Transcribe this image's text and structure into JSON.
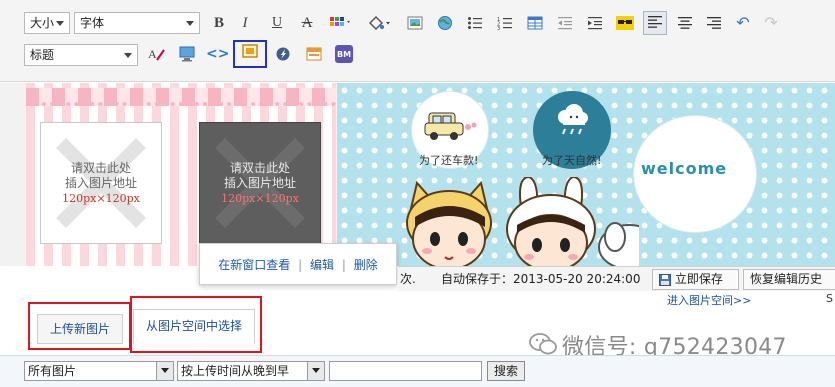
{
  "toolbar": {
    "font_size_label": "大小",
    "font_family_label": "字体",
    "heading_label": "标题",
    "buttons": {
      "bold": "B",
      "italic": "I",
      "underline": "U",
      "strikethrough": "A"
    }
  },
  "canvas": {
    "placeholder_1": {
      "line1": "请双击此处",
      "line2": "插入图片地址",
      "size": "120px×120px"
    },
    "placeholder_2": {
      "line1": "请双击此处",
      "line2": "插入图片地址",
      "size": "120px×120px"
    },
    "caption_car": "为了还车款!",
    "caption_rain": "为了天自然!",
    "welcome": "welcome"
  },
  "popup": {
    "view_new_window": "在新窗口查看",
    "edit": "编辑",
    "delete": "删除",
    "separator": "|"
  },
  "statusbar": {
    "partial_text": "次.",
    "autosave": "自动保存于：2013-05-20 20:24:00",
    "save_now": "立即保存",
    "restore_history": "恢复编辑历史"
  },
  "tabs": {
    "upload_new": "上传新图片",
    "choose_from_space": "从图片空间中选择"
  },
  "filter": {
    "category": "所有图片",
    "sort": "按上传时间从晚到早",
    "search_button": "搜索"
  },
  "right_link": "进入图片空间>>",
  "corner_letter": "S",
  "watermark": "微信号: q752423047",
  "colors": {
    "highlight_box": "#2233bb",
    "annotation_red": "#e0141e",
    "blue_bg": "#b3e1ec",
    "pink_stripe": "#fbd7de"
  }
}
